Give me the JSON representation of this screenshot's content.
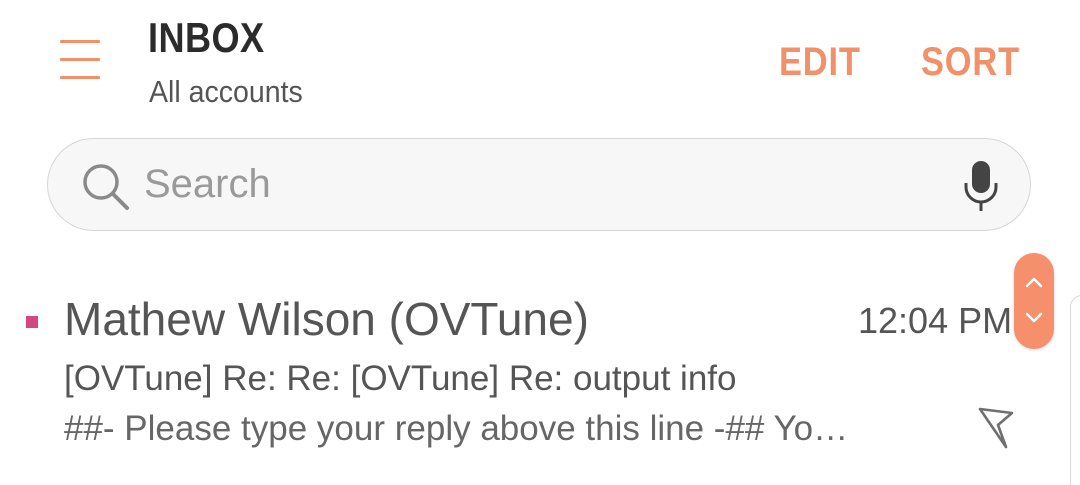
{
  "header": {
    "title": "INBOX",
    "subtitle": "All accounts",
    "edit_label": "EDIT",
    "sort_label": "SORT"
  },
  "search": {
    "placeholder": "Search"
  },
  "emails": [
    {
      "sender": "Mathew Wilson (OVTune)",
      "time": "12:04 PM",
      "subject": "[OVTune] Re: Re: [OVTune] Re: output info",
      "preview": "##- Please type your reply above this line -##  Yo…",
      "unread": true
    }
  ],
  "icons": {
    "menu": "hamburger-menu-icon",
    "search": "search-icon",
    "mic": "microphone-icon",
    "flag": "flag-icon",
    "scroll_up": "chevron-up-icon",
    "scroll_down": "chevron-down-icon"
  },
  "colors": {
    "accent": "#f2906a",
    "unread_marker": "#d6457e",
    "text_primary": "#2b2b2b",
    "text_secondary": "#555555"
  }
}
